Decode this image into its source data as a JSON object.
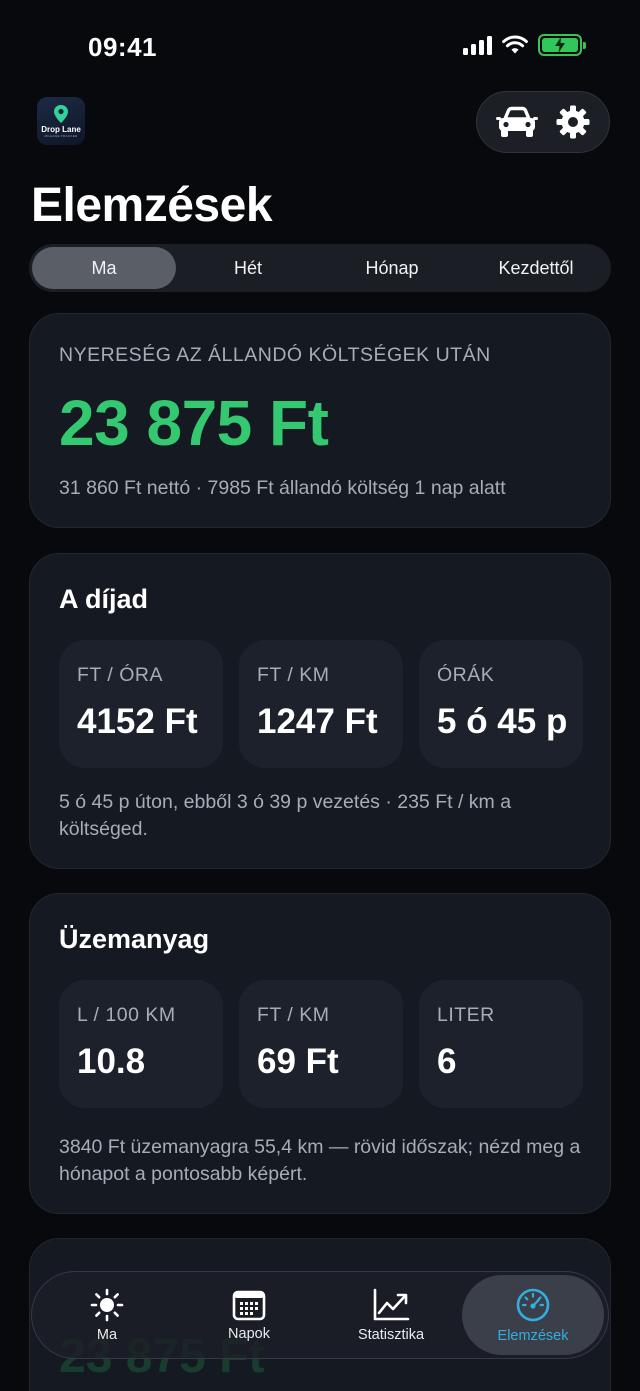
{
  "status": {
    "time": "09:41"
  },
  "app": {
    "logo_text": "Drop Lane",
    "logo_sub": "MILEAGE TRACKER"
  },
  "page": {
    "title": "Elemzések"
  },
  "segments": [
    {
      "label": "Ma",
      "active": true
    },
    {
      "label": "Hét",
      "active": false
    },
    {
      "label": "Hónap",
      "active": false
    },
    {
      "label": "Kezdettől",
      "active": false
    }
  ],
  "profit": {
    "overline": "NYERESÉG AZ ÁLLANDÓ KÖLTSÉGEK UTÁN",
    "value": "23 875 Ft",
    "note": "31 860 Ft nettó · 7985 Ft állandó költség 1 nap alatt"
  },
  "rate": {
    "title": "A díjad",
    "tiles": [
      {
        "label": "FT / ÓRA",
        "value": "4152 Ft"
      },
      {
        "label": "FT / KM",
        "value": "1247 Ft"
      },
      {
        "label": "ÓRÁK",
        "value": "5 ó 45 p"
      }
    ],
    "note": "5 ó 45 p úton, ebből 3 ó 39 p vezetés · 235 Ft / km a költséged."
  },
  "fuel": {
    "title": "Üzemanyag",
    "tiles": [
      {
        "label": "L / 100 KM",
        "value": "10.8"
      },
      {
        "label": "FT / KM",
        "value": "69 Ft"
      },
      {
        "label": "LITER",
        "value": "6"
      }
    ],
    "note": "3840 Ft üzemanyagra 55,4 km — rövid időszak; nézd meg a hónapot a pontosabb képért."
  },
  "ghost": {
    "value": "23 875 Ft"
  },
  "tabs": [
    {
      "label": "Ma",
      "icon": "sun-icon",
      "active": false
    },
    {
      "label": "Napok",
      "icon": "calendar-icon",
      "active": false
    },
    {
      "label": "Statisztika",
      "icon": "chart-line-icon",
      "active": false
    },
    {
      "label": "Elemzések",
      "icon": "speedometer-icon",
      "active": true
    }
  ],
  "colors": {
    "accent_green": "#34c870",
    "accent_blue": "#34aee0",
    "background": "#07090d",
    "card": "#151922"
  }
}
